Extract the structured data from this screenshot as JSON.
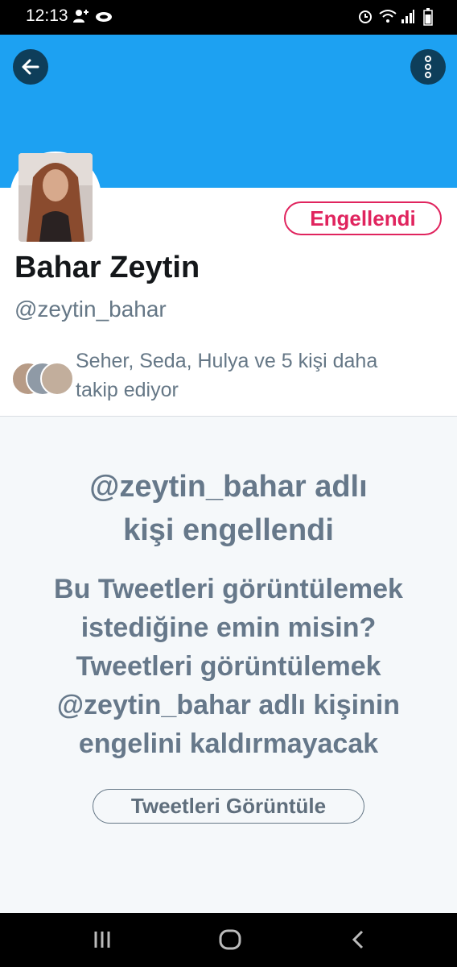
{
  "status_bar": {
    "time": "12:13",
    "icons": [
      "person-add-icon",
      "cloud-icon",
      "alarm-icon",
      "wifi-icon",
      "signal-icon",
      "battery-icon"
    ]
  },
  "header": {
    "back_icon": "back-arrow-icon",
    "more_icon": "more-vertical-icon",
    "banner_color": "#1da1f2"
  },
  "profile": {
    "name": "Bahar Zeytin",
    "handle": "@zeytin_bahar",
    "blocked_label": "Engellendi",
    "followed_by_line1": "Seher, Seda, Hulya ve 5 kişi daha",
    "followed_by_line2": "takip ediyor"
  },
  "block_panel": {
    "title_line1": "@zeytin_bahar adlı",
    "title_line2": "kişi engellendi",
    "desc_line1": "Bu Tweetleri görüntülemek",
    "desc_line2": "istediğine emin misin?",
    "desc_line3": "Tweetleri görüntülemek",
    "desc_line4": "@zeytin_bahar adlı kişinin",
    "desc_line5": "engelini kaldırmayacak",
    "view_button": "Tweetleri Görüntüle"
  },
  "nav_bar": {
    "icons": [
      "recent-apps-icon",
      "home-icon",
      "back-icon"
    ]
  },
  "colors": {
    "accent": "#1da1f2",
    "blocked": "#e0245e",
    "muted_text": "#657786",
    "panel_bg": "#f5f8fa"
  }
}
